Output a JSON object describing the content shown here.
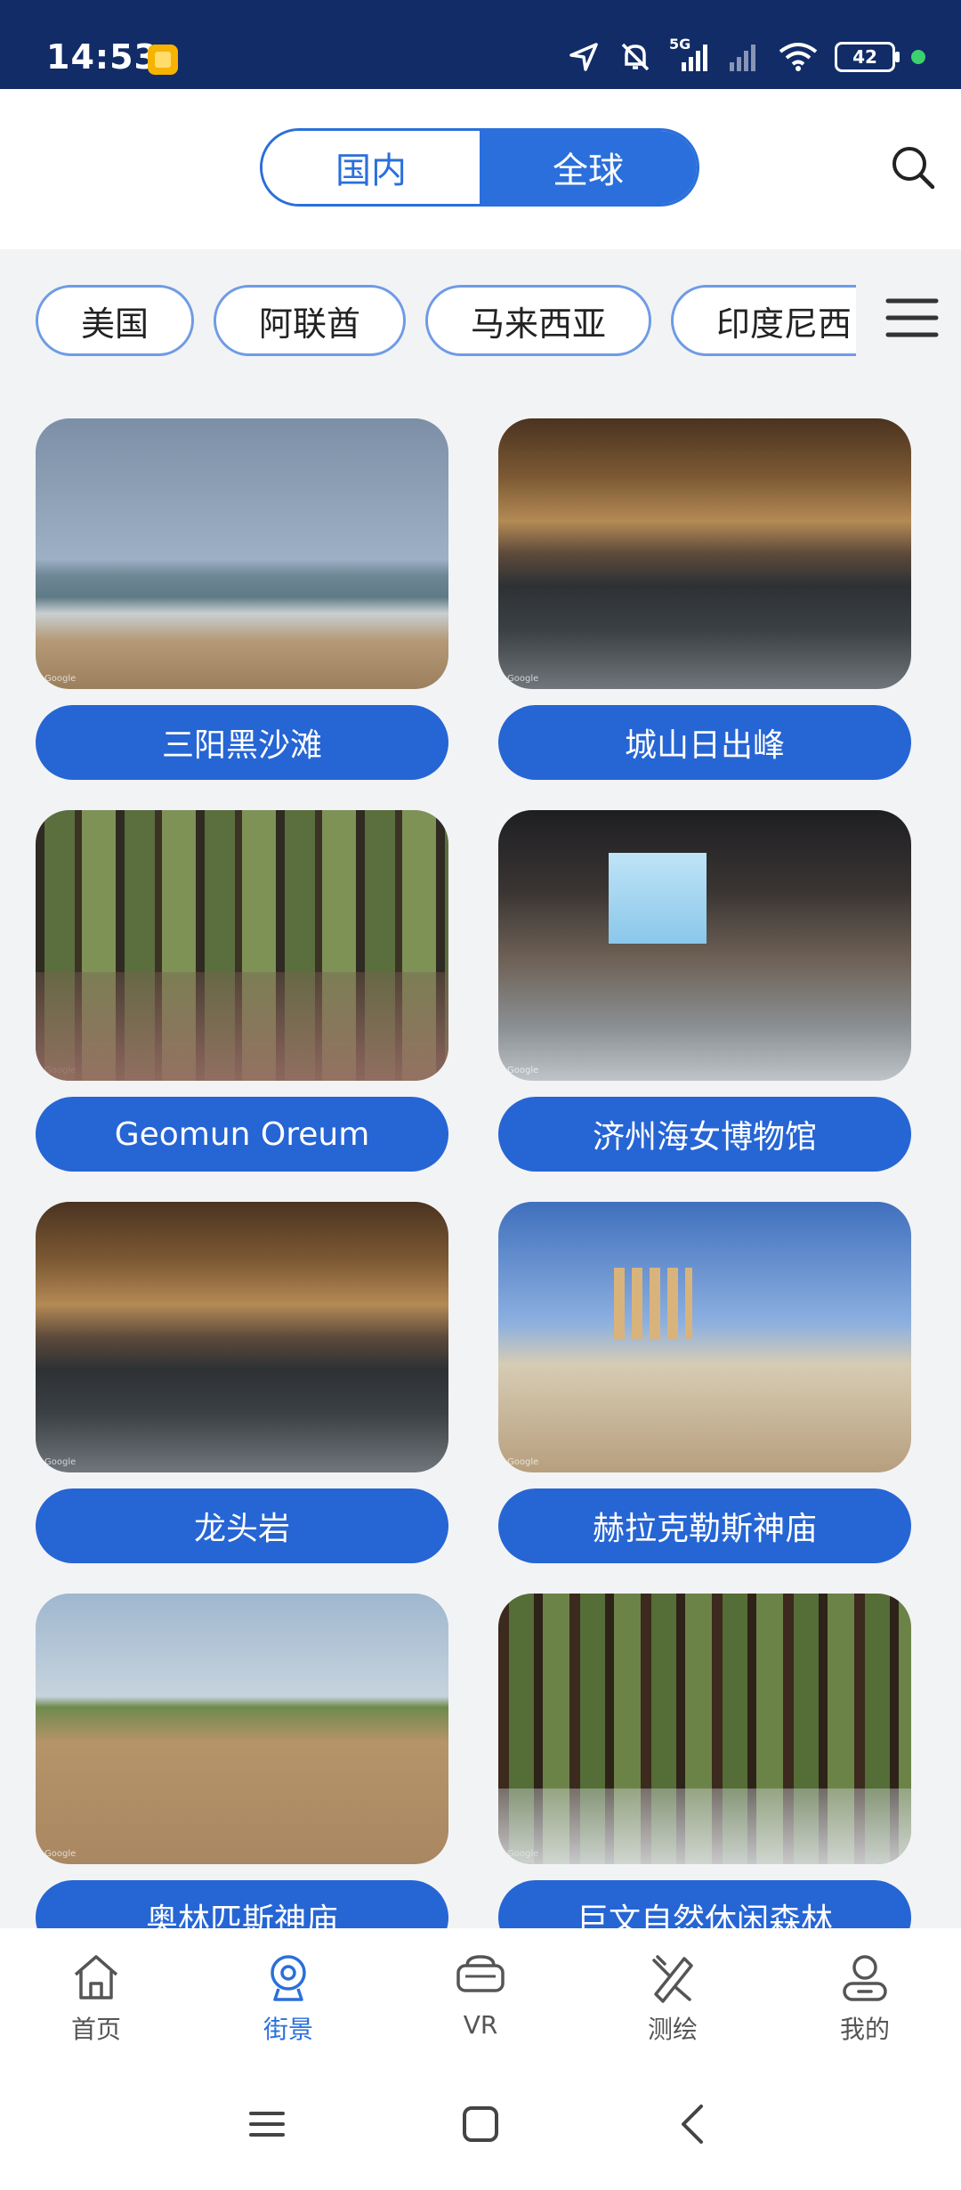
{
  "status_bar": {
    "time": "14:53",
    "battery": "42",
    "network": "5G"
  },
  "header": {
    "tabs": [
      {
        "label": "国内",
        "active": false
      },
      {
        "label": "全球",
        "active": true
      }
    ]
  },
  "countries": [
    "美国",
    "阿联酋",
    "马来西亚",
    "印度尼西"
  ],
  "places": [
    {
      "name": "三阳黑沙滩",
      "thumb": "beach"
    },
    {
      "name": "城山日出峰",
      "thumb": "hall"
    },
    {
      "name": "Geomun Oreum",
      "thumb": "forest"
    },
    {
      "name": "济州海女博物馆",
      "thumb": "museum"
    },
    {
      "name": "龙头岩",
      "thumb": "hall"
    },
    {
      "name": "赫拉克勒斯神庙",
      "thumb": "temple"
    },
    {
      "name": "奥林匹斯神庙",
      "thumb": "olympia"
    },
    {
      "name": "巨文自然休闲森林",
      "thumb": "woods"
    }
  ],
  "bottom_nav": [
    {
      "label": "首页",
      "icon": "home-icon",
      "active": false
    },
    {
      "label": "街景",
      "icon": "streetview-icon",
      "active": true
    },
    {
      "label": "VR",
      "icon": "vr-icon",
      "active": false
    },
    {
      "label": "测绘",
      "icon": "survey-icon",
      "active": false
    },
    {
      "label": "我的",
      "icon": "profile-icon",
      "active": false
    }
  ],
  "colors": {
    "accent": "#2a6fdb",
    "status_bar": "#112c67",
    "label_bg": "#2665d4"
  }
}
